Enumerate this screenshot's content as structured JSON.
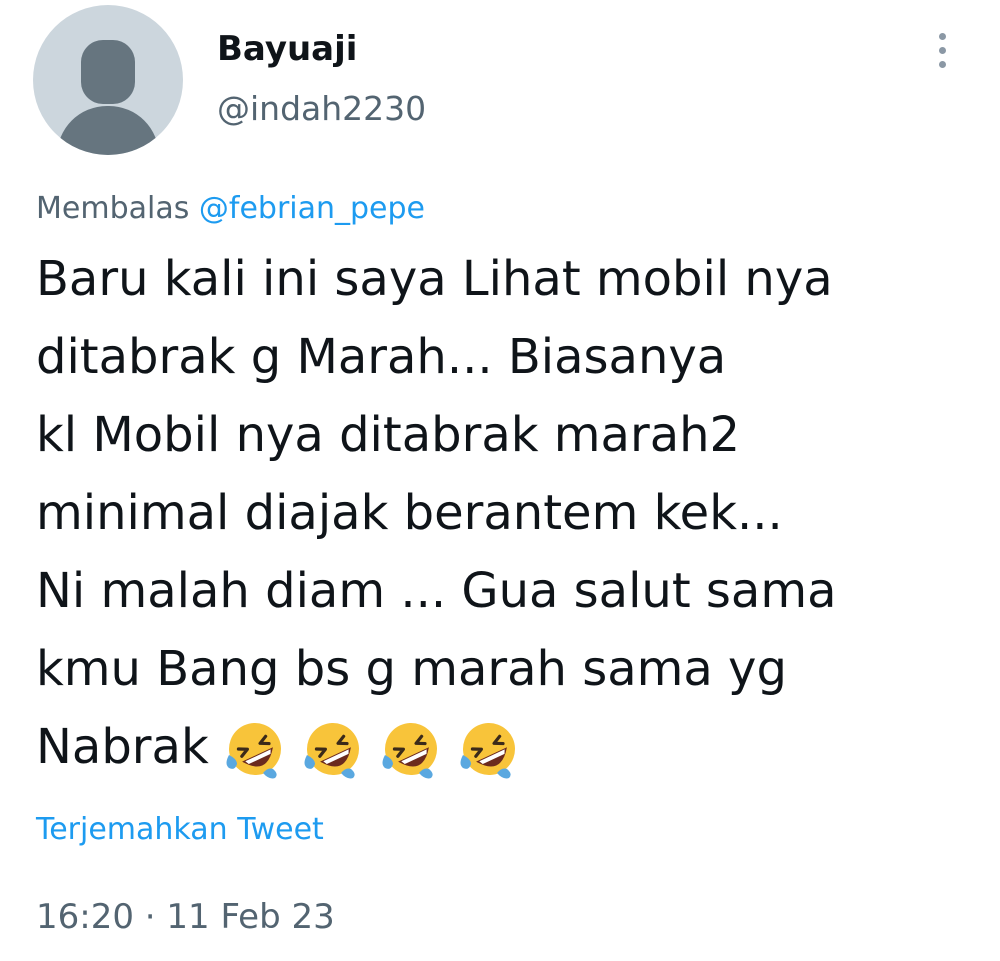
{
  "author": {
    "display_name": "Bayuaji",
    "handle": "@indah2230",
    "avatar_icon": "default-profile-silhouette-icon"
  },
  "more_icon": "vertical-ellipsis-icon",
  "reply": {
    "prefix": "Membalas",
    "mention": "@febrian_pepe"
  },
  "tweet": {
    "lines": [
      "Baru kali ini saya Lihat mobil nya",
      "ditabrak g Marah... Biasanya",
      "kl Mobil nya ditabrak marah2",
      "minimal diajak berantem kek...",
      "Ni malah diam ... Gua salut sama",
      "kmu Bang bs g marah sama yg",
      "Nabrak"
    ],
    "emojis": [
      "🤣",
      "🤣",
      "🤣",
      "🤣"
    ]
  },
  "translate_label": "Terjemahkan Tweet",
  "timestamp": "16:20 · 11 Feb 23",
  "colors": {
    "text": "#0f1419",
    "secondary": "#536471",
    "link": "#1d9bf0",
    "avatar_bg": "#ccd6dd",
    "avatar_fg": "#66757f",
    "emoji_face": "#f8c43a",
    "emoji_tear": "#5aa8e0"
  }
}
